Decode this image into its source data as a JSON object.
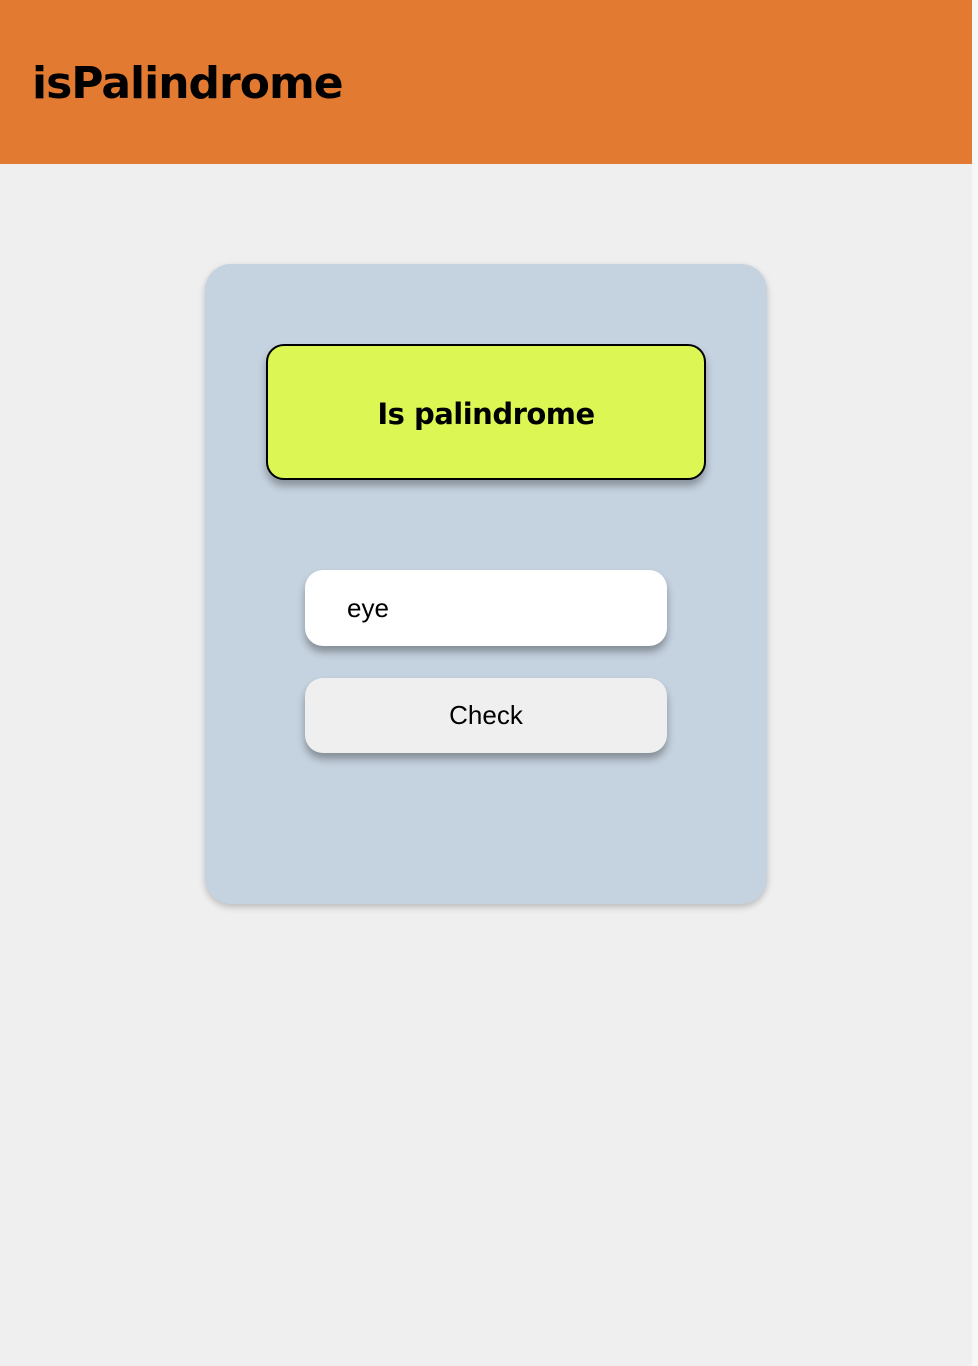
{
  "header": {
    "title": "isPalindrome",
    "background_color": "#e37a31"
  },
  "card": {
    "background_color": "#c5d2df",
    "result": {
      "text": "Is palindrome",
      "background_color": "#dcf654"
    },
    "input": {
      "value": "eye",
      "placeholder": ""
    },
    "check_button": {
      "label": "Check"
    }
  }
}
